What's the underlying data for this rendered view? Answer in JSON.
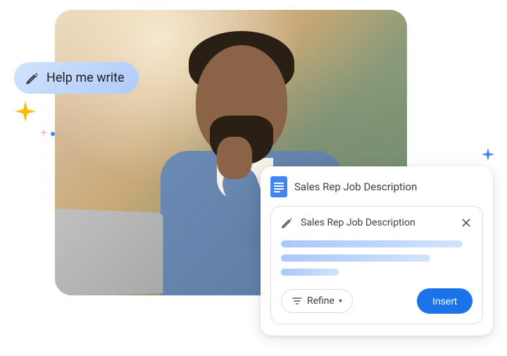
{
  "help_pill": {
    "label": "Help me write"
  },
  "card": {
    "header_title": "Sales Rep Job Description",
    "prompt": {
      "text": "Sales Rep Job Description"
    },
    "actions": {
      "refine_label": "Refine",
      "insert_label": "Insert"
    }
  }
}
